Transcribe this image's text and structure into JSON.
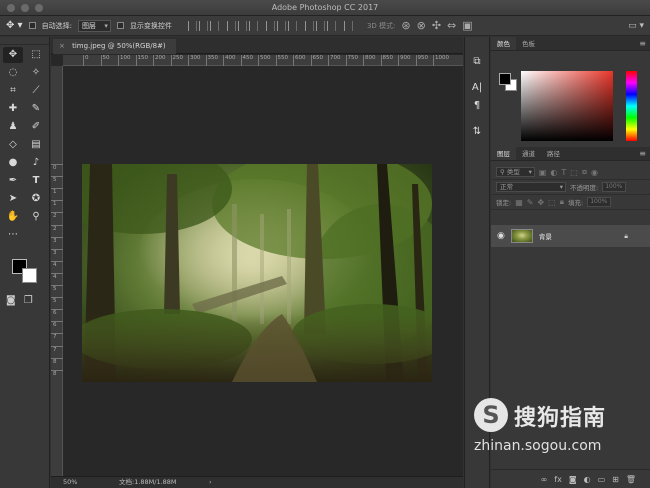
{
  "window": {
    "title": "Adobe Photoshop CC 2017"
  },
  "options_bar": {
    "auto_select_label": "自动选择:",
    "auto_select_target": "图层",
    "show_transform_label": "显示变换控件",
    "mode_3d_label": "3D 模式:"
  },
  "toolbox": {
    "tools": [
      "move",
      "marquee",
      "lasso",
      "magic-wand",
      "crop",
      "eyedropper",
      "healing-brush",
      "brush",
      "clone-stamp",
      "history-brush",
      "eraser",
      "gradient",
      "blur",
      "dodge",
      "pen",
      "type",
      "path-select",
      "shape",
      "hand",
      "zoom",
      "more",
      "extras"
    ],
    "foreground_color": "#000000",
    "background_color": "#ffffff"
  },
  "document": {
    "tab_title": "timg.jpeg @ 50%(RGB/8#)",
    "ruler_h": [
      "0",
      "50",
      "100",
      "150",
      "200",
      "250",
      "300",
      "350",
      "400",
      "450",
      "500",
      "550",
      "600",
      "650",
      "700",
      "750",
      "800",
      "850",
      "900",
      "950",
      "1000"
    ],
    "ruler_v": [
      "0",
      "5",
      "1",
      "1",
      "2",
      "2",
      "3",
      "3",
      "4",
      "4",
      "5",
      "5",
      "6",
      "6",
      "7",
      "7",
      "8",
      "8"
    ],
    "zoom": "50%",
    "doc_info": "文档:1.88M/1.88M",
    "status_arrow": "›"
  },
  "panels": {
    "color_tabs": [
      "颜色",
      "色板"
    ],
    "layer_tabs": [
      "图层",
      "通道",
      "路径"
    ],
    "kind_filter": "类型",
    "blend_mode": "正常",
    "opacity_label": "不透明度:",
    "opacity_value": "100%",
    "lock_label": "锁定:",
    "fill_label": "填充:",
    "fill_value": "100%",
    "layer_name": "背景"
  },
  "watermark": {
    "logo_letter": "S",
    "brand_cn": "搜狗指南",
    "url": "zhinan.sogou.com"
  }
}
